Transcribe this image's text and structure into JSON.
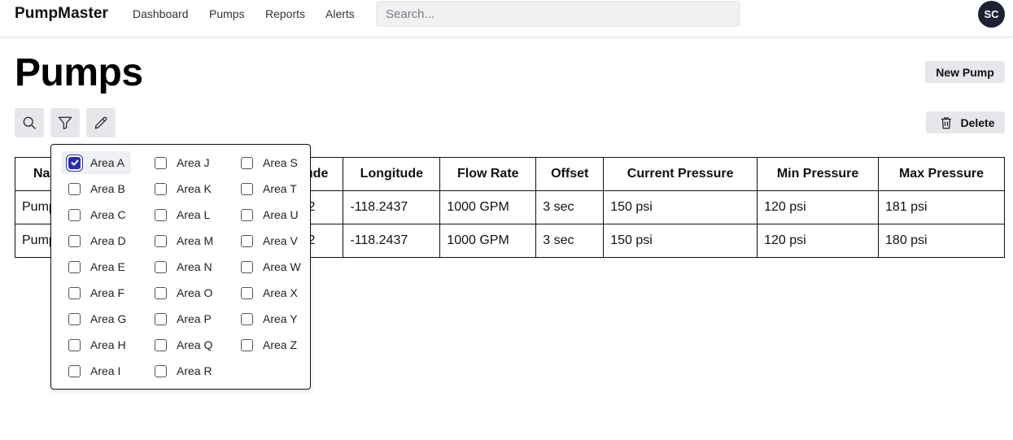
{
  "header": {
    "brand": "PumpMaster",
    "nav": [
      "Dashboard",
      "Pumps",
      "Reports",
      "Alerts"
    ],
    "search_placeholder": "Search...",
    "avatar_initials": "SC"
  },
  "page": {
    "title": "Pumps",
    "new_button": "New Pump",
    "delete_button": "Delete",
    "tools": [
      "search-icon",
      "filter-icon",
      "pencil-icon"
    ]
  },
  "table": {
    "columns": [
      "Na",
      "ude",
      "Longitude",
      "Flow Rate",
      "Offset",
      "Current Pressure",
      "Min Pressure",
      "Max Pressure"
    ],
    "rows": [
      [
        "Pump",
        "2",
        "-118.2437",
        "1000 GPM",
        "3 sec",
        "150 psi",
        "120 psi",
        "181 psi"
      ],
      [
        "Pump",
        "2",
        "-118.2437",
        "1000 GPM",
        "3 sec",
        "150 psi",
        "120 psi",
        "180 psi"
      ]
    ]
  },
  "area_filter": {
    "options": [
      {
        "label": "Area A",
        "checked": true
      },
      {
        "label": "Area B",
        "checked": false
      },
      {
        "label": "Area C",
        "checked": false
      },
      {
        "label": "Area D",
        "checked": false
      },
      {
        "label": "Area E",
        "checked": false
      },
      {
        "label": "Area F",
        "checked": false
      },
      {
        "label": "Area G",
        "checked": false
      },
      {
        "label": "Area H",
        "checked": false
      },
      {
        "label": "Area I",
        "checked": false
      },
      {
        "label": "Area J",
        "checked": false
      },
      {
        "label": "Area K",
        "checked": false
      },
      {
        "label": "Area L",
        "checked": false
      },
      {
        "label": "Area M",
        "checked": false
      },
      {
        "label": "Area N",
        "checked": false
      },
      {
        "label": "Area O",
        "checked": false
      },
      {
        "label": "Area P",
        "checked": false
      },
      {
        "label": "Area Q",
        "checked": false
      },
      {
        "label": "Area R",
        "checked": false
      },
      {
        "label": "Area S",
        "checked": false
      },
      {
        "label": "Area T",
        "checked": false
      },
      {
        "label": "Area U",
        "checked": false
      },
      {
        "label": "Area V",
        "checked": false
      },
      {
        "label": "Area W",
        "checked": false
      },
      {
        "label": "Area X",
        "checked": false
      },
      {
        "label": "Area Y",
        "checked": false
      },
      {
        "label": "Area Z",
        "checked": false
      }
    ]
  },
  "colors": {
    "avatar_bg": "#1d2233",
    "checkbox_accent": "#2e2ea8",
    "button_bg": "#e6e7ea"
  }
}
